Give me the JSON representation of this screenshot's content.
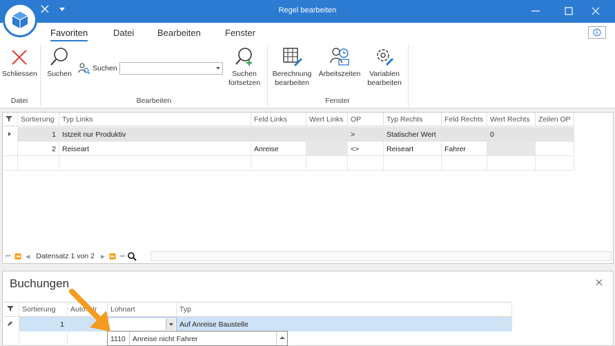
{
  "window": {
    "title": "Regel bearbeiten"
  },
  "ribbon": {
    "tabs": [
      "Favoriten",
      "Datei",
      "Bearbeiten",
      "Fenster"
    ],
    "buttons": {
      "schliessen": "Schliessen",
      "suchen": "Suchen",
      "suchen_inline": "Suchen",
      "suchen_fortsetzen_1": "Suchen",
      "suchen_fortsetzen_2": "fortsetzen",
      "berechnung_1": "Berechnung",
      "berechnung_2": "bearbeiten",
      "arbeitszeiten": "Arbeitszeiten",
      "variablen_1": "Variablen",
      "variablen_2": "bearbeiten"
    },
    "groups": {
      "datei": "Datei",
      "bearbeiten": "Bearbeiten",
      "fenster": "Fenster"
    },
    "search_value": ""
  },
  "rules_grid": {
    "columns": [
      "Sortierung",
      "Typ Links",
      "Feld Links",
      "Wert Links",
      "OP",
      "Typ Rechts",
      "Feld Rechts",
      "Wert Rechts",
      "Zeilen OP"
    ],
    "rows": [
      {
        "sortierung": "1",
        "typ_links": "Istzeit nur Produktiv",
        "feld_links": "",
        "wert_links": "",
        "op": ">",
        "typ_rechts": "Statischer Wert",
        "feld_rechts": "",
        "wert_rechts": "0",
        "zeilen_op": ""
      },
      {
        "sortierung": "2",
        "typ_links": "Reiseart",
        "feld_links": "Anreise",
        "wert_links": "",
        "op": "<>",
        "typ_rechts": "Reiseart",
        "feld_rechts": "Fahrer",
        "wert_rechts": "",
        "zeilen_op": ""
      }
    ],
    "navigator": "Datensatz 1 von 2"
  },
  "buchungen": {
    "title": "Buchungen",
    "columns": [
      "Sortierung",
      "Auto. Nr",
      "Lohnart",
      "Typ"
    ],
    "rows": [
      {
        "sortierung": "1",
        "auto_nr": "",
        "lohnart": "",
        "typ": "Auf Anreise Baustelle"
      }
    ],
    "dropdown": {
      "code": "1110",
      "label": "Anreise nicht Fahrer"
    }
  },
  "colors": {
    "accent": "#2b7bd3",
    "selection": "#cfe3f7",
    "annotation_arrow": "#f39c1f"
  }
}
